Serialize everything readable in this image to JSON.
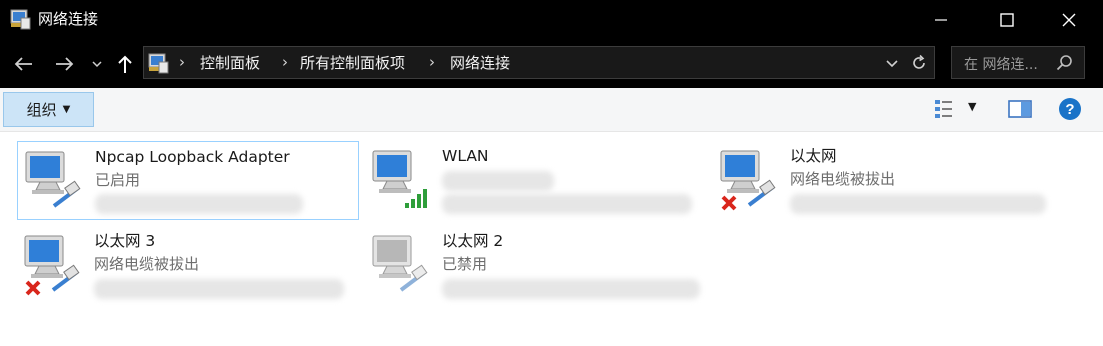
{
  "window": {
    "title": "网络连接",
    "minimize_icon": "minimize-icon",
    "maximize_icon": "maximize-icon",
    "close_icon": "close-icon"
  },
  "address_bar": {
    "breadcrumbs": [
      "控制面板",
      "所有控制面板项",
      "网络连接"
    ],
    "separator": "›",
    "search_placeholder": "在 网络连...",
    "icons": [
      "back-arrow-icon",
      "forward-arrow-icon",
      "chevron-down-icon",
      "up-arrow-icon",
      "control-panel-icon",
      "refresh-icon",
      "search-icon"
    ]
  },
  "command_bar": {
    "organize_label": "组织",
    "organize_caret": "▼",
    "view_caret": "▼",
    "icons": [
      "change-view-icon",
      "preview-pane-icon",
      "help-icon"
    ]
  },
  "connections": [
    {
      "name": "Npcap Loopback Adapter",
      "status": "已启用",
      "state": "enabled",
      "selected": true
    },
    {
      "name": "WLAN",
      "status": "",
      "state": "wifi",
      "selected": false
    },
    {
      "name": "以太网",
      "status": "网络电缆被拔出",
      "state": "unplugged",
      "selected": false
    },
    {
      "name": "以太网 3",
      "status": "网络电缆被拔出",
      "state": "unplugged",
      "selected": false
    },
    {
      "name": "以太网 2",
      "status": "已禁用",
      "state": "disabled",
      "selected": false
    }
  ],
  "colors": {
    "titlebar_bg": "#000000",
    "commandbar_bg": "#f5f6f7",
    "organize_bg": "#cce4f7",
    "selection_border": "#99d1ff",
    "help_blue": "#1a73c8",
    "wifi_green": "#2e9e3a",
    "unplugged_red": "#d9261c"
  }
}
